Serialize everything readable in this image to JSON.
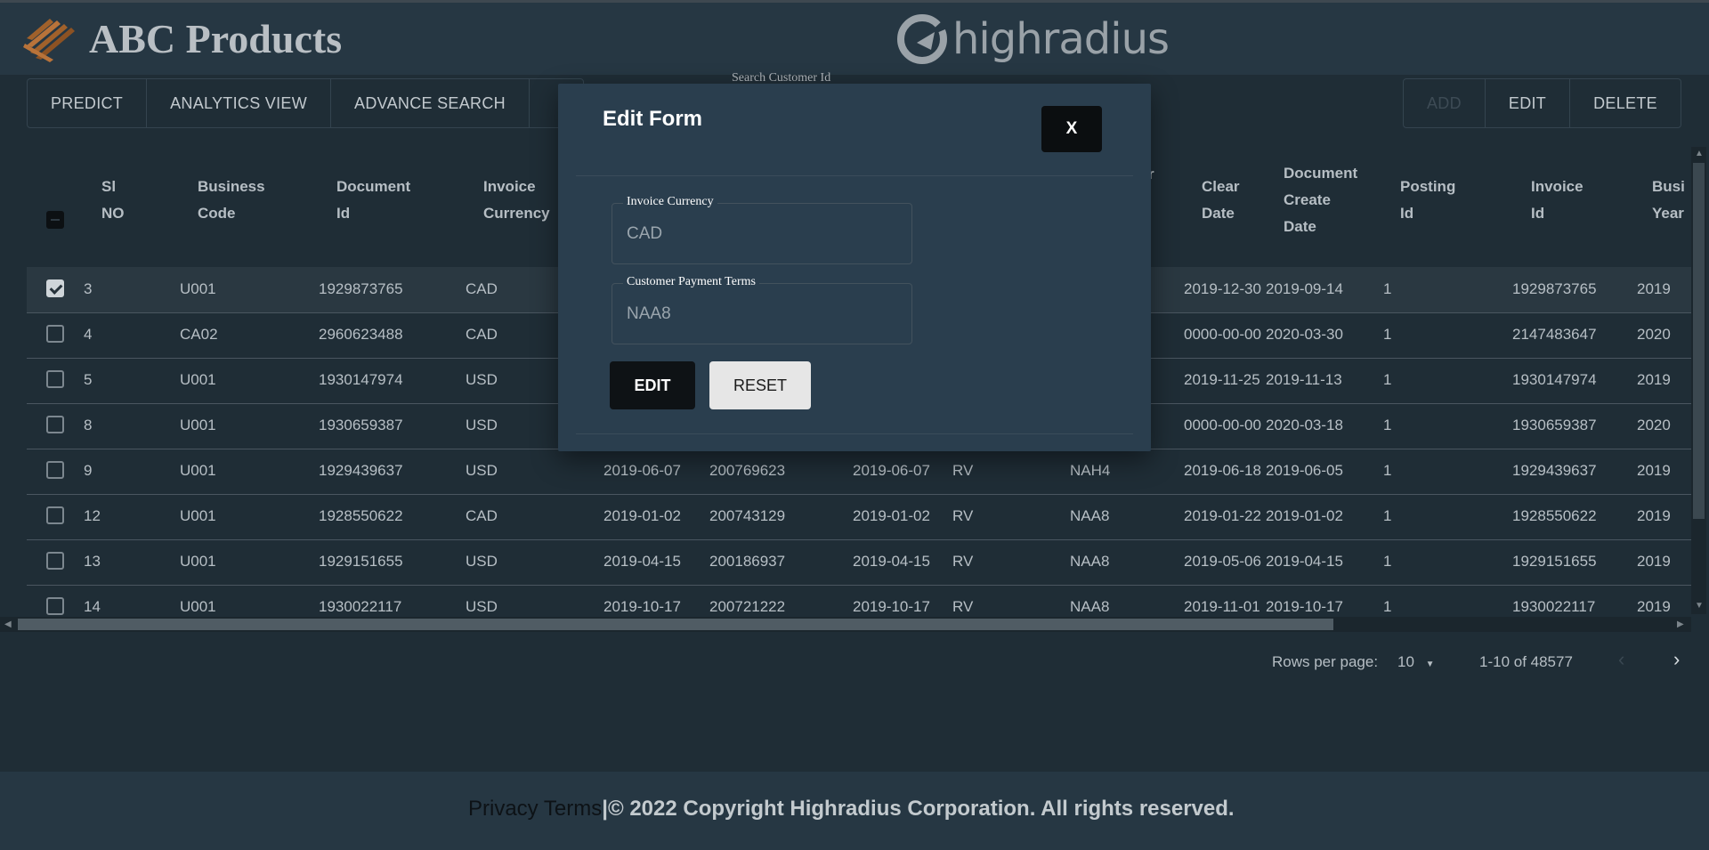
{
  "header": {
    "app_title": "ABC Products",
    "brand_text": "highradius"
  },
  "search": {
    "label": "Search Customer Id"
  },
  "toolbar": {
    "left_buttons": [
      "PREDICT",
      "ANALYTICS VIEW",
      "ADVANCE SEARCH"
    ],
    "right_buttons": [
      "ADD",
      "EDIT",
      "DELETE"
    ]
  },
  "table": {
    "columns": [
      "Sl NO",
      "Business Code",
      "Document Id",
      "Invoice Currency",
      "",
      "",
      "",
      "",
      "r",
      "Clear Date",
      "Document Create Date",
      "Posting Id",
      "Invoice Id",
      "Business Year"
    ],
    "headers": {
      "sl_no": [
        "Sl",
        "NO"
      ],
      "business_code": [
        "Business",
        "Code"
      ],
      "document_id": [
        "Document",
        "Id"
      ],
      "invoice_currency": [
        "Invoice",
        "Currency"
      ],
      "partial": "r",
      "clear_date": [
        "Clear",
        "Date"
      ],
      "document_create_date": [
        "Document",
        "Create",
        "Date"
      ],
      "posting_id": [
        "Posting",
        "Id"
      ],
      "invoice_id": [
        "Invoice",
        "Id"
      ],
      "business_year": [
        "Busi",
        "Year"
      ]
    },
    "rows": [
      {
        "sl": "3",
        "code": "U001",
        "doc": "1929873765",
        "cur": "CAD",
        "c5": "",
        "c6": "",
        "c7": "",
        "c8": "",
        "terms": "",
        "clear": "2019-12-30",
        "create": "2019-09-14",
        "post": "1",
        "inv": "1929873765",
        "year": "2019",
        "checked": true
      },
      {
        "sl": "4",
        "code": "CA02",
        "doc": "2960623488",
        "cur": "CAD",
        "c5": "",
        "c6": "",
        "c7": "",
        "c8": "",
        "terms": "",
        "clear": "0000-00-00",
        "create": "2020-03-30",
        "post": "1",
        "inv": "2147483647",
        "year": "2020",
        "checked": false
      },
      {
        "sl": "5",
        "code": "U001",
        "doc": "1930147974",
        "cur": "USD",
        "c5": "",
        "c6": "",
        "c7": "",
        "c8": "",
        "terms": "",
        "clear": "2019-11-25",
        "create": "2019-11-13",
        "post": "1",
        "inv": "1930147974",
        "year": "2019",
        "checked": false
      },
      {
        "sl": "8",
        "code": "U001",
        "doc": "1930659387",
        "cur": "USD",
        "c5": "",
        "c6": "",
        "c7": "",
        "c8": "",
        "terms": "",
        "clear": "0000-00-00",
        "create": "2020-03-18",
        "post": "1",
        "inv": "1930659387",
        "year": "2020",
        "checked": false
      },
      {
        "sl": "9",
        "code": "U001",
        "doc": "1929439637",
        "cur": "USD",
        "c5": "2019-06-07",
        "c6": "200769623",
        "c7": "2019-06-07",
        "c8": "RV",
        "terms": "NAH4",
        "clear": "2019-06-18",
        "create": "2019-06-05",
        "post": "1",
        "inv": "1929439637",
        "year": "2019",
        "checked": false
      },
      {
        "sl": "12",
        "code": "U001",
        "doc": "1928550622",
        "cur": "CAD",
        "c5": "2019-01-02",
        "c6": "200743129",
        "c7": "2019-01-02",
        "c8": "RV",
        "terms": "NAA8",
        "clear": "2019-01-22",
        "create": "2019-01-02",
        "post": "1",
        "inv": "1928550622",
        "year": "2019",
        "checked": false
      },
      {
        "sl": "13",
        "code": "U001",
        "doc": "1929151655",
        "cur": "USD",
        "c5": "2019-04-15",
        "c6": "200186937",
        "c7": "2019-04-15",
        "c8": "RV",
        "terms": "NAA8",
        "clear": "2019-05-06",
        "create": "2019-04-15",
        "post": "1",
        "inv": "1929151655",
        "year": "2019",
        "checked": false
      },
      {
        "sl": "14",
        "code": "U001",
        "doc": "1930022117",
        "cur": "USD",
        "c5": "2019-10-17",
        "c6": "200721222",
        "c7": "2019-10-17",
        "c8": "RV",
        "terms": "NAA8",
        "clear": "2019-11-01",
        "create": "2019-10-17",
        "post": "1",
        "inv": "1930022117",
        "year": "2019",
        "checked": false
      }
    ]
  },
  "pagination": {
    "rows_per_page_label": "Rows per page:",
    "rows_per_page_value": "10",
    "range": "1-10 of 48577"
  },
  "footer": {
    "link_text": "Privacy Terms",
    "separator": "|",
    "copyright": "© 2022 Copyright Highradius Corporation. All rights reserved."
  },
  "modal": {
    "title": "Edit Form",
    "close_label": "X",
    "fields": [
      {
        "label": "Invoice Currency",
        "value": "CAD"
      },
      {
        "label": "Customer Payment Terms",
        "value": "NAA8"
      }
    ],
    "edit_label": "EDIT",
    "reset_label": "RESET"
  },
  "colors": {
    "background": "#1f2d36",
    "header": "#263743",
    "modal": "#2a3e4e",
    "accent_dark": "#0e1215"
  },
  "icons": [
    "logo-icon",
    "brand-logo-icon",
    "checkbox-icon",
    "chevron-down-icon",
    "chevron-left-icon",
    "chevron-right-icon"
  ]
}
